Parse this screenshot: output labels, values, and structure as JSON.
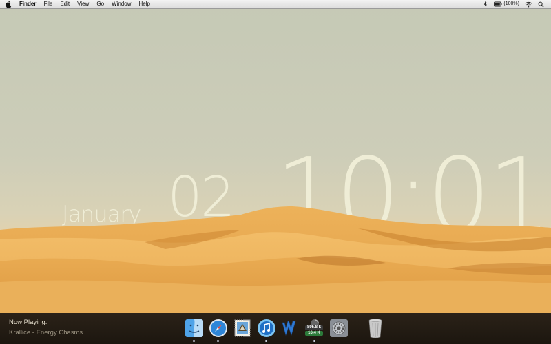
{
  "menubar": {
    "app_name": "Finder",
    "items": [
      "File",
      "Edit",
      "View",
      "Go",
      "Window",
      "Help"
    ],
    "battery": "(100%)"
  },
  "clock": {
    "month": "January",
    "day": "02",
    "time": "10:01"
  },
  "now_playing": {
    "label": "Now Playing:",
    "track": "Krallice - Energy Chasms"
  },
  "dock": {
    "items": [
      {
        "icon": "finder-icon",
        "running": true
      },
      {
        "icon": "safari-icon",
        "running": true
      },
      {
        "icon": "mail-stamp-icon",
        "running": false
      },
      {
        "icon": "itunes-icon",
        "running": true
      },
      {
        "icon": "word-icon",
        "running": false
      },
      {
        "icon": "network-monitor-icon",
        "running": true,
        "upload": "895.8 k",
        "download": "16.4 K"
      },
      {
        "icon": "system-preferences-icon",
        "running": false
      },
      {
        "icon": "trash-icon",
        "running": false
      }
    ]
  },
  "colors": {
    "clock_text": "#f1efd8",
    "sand": "#e8a84a",
    "sky": "#c8cab8",
    "bar": "#221b13"
  }
}
